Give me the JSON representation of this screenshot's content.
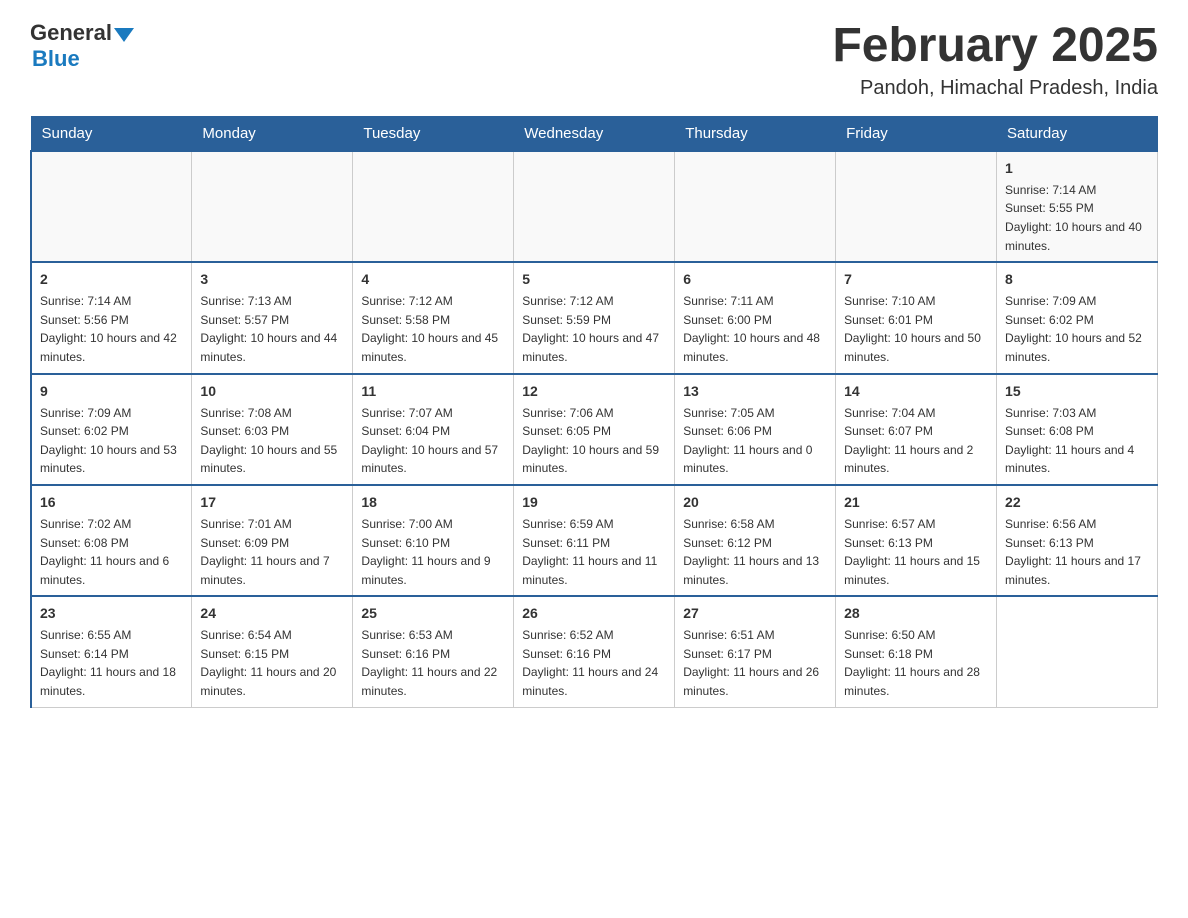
{
  "logo": {
    "part1": "General",
    "part2": "Blue"
  },
  "title": "February 2025",
  "subtitle": "Pandoh, Himachal Pradesh, India",
  "days_of_week": [
    "Sunday",
    "Monday",
    "Tuesday",
    "Wednesday",
    "Thursday",
    "Friday",
    "Saturday"
  ],
  "weeks": [
    [
      {
        "day": "",
        "info": ""
      },
      {
        "day": "",
        "info": ""
      },
      {
        "day": "",
        "info": ""
      },
      {
        "day": "",
        "info": ""
      },
      {
        "day": "",
        "info": ""
      },
      {
        "day": "",
        "info": ""
      },
      {
        "day": "1",
        "info": "Sunrise: 7:14 AM\nSunset: 5:55 PM\nDaylight: 10 hours and 40 minutes."
      }
    ],
    [
      {
        "day": "2",
        "info": "Sunrise: 7:14 AM\nSunset: 5:56 PM\nDaylight: 10 hours and 42 minutes."
      },
      {
        "day": "3",
        "info": "Sunrise: 7:13 AM\nSunset: 5:57 PM\nDaylight: 10 hours and 44 minutes."
      },
      {
        "day": "4",
        "info": "Sunrise: 7:12 AM\nSunset: 5:58 PM\nDaylight: 10 hours and 45 minutes."
      },
      {
        "day": "5",
        "info": "Sunrise: 7:12 AM\nSunset: 5:59 PM\nDaylight: 10 hours and 47 minutes."
      },
      {
        "day": "6",
        "info": "Sunrise: 7:11 AM\nSunset: 6:00 PM\nDaylight: 10 hours and 48 minutes."
      },
      {
        "day": "7",
        "info": "Sunrise: 7:10 AM\nSunset: 6:01 PM\nDaylight: 10 hours and 50 minutes."
      },
      {
        "day": "8",
        "info": "Sunrise: 7:09 AM\nSunset: 6:02 PM\nDaylight: 10 hours and 52 minutes."
      }
    ],
    [
      {
        "day": "9",
        "info": "Sunrise: 7:09 AM\nSunset: 6:02 PM\nDaylight: 10 hours and 53 minutes."
      },
      {
        "day": "10",
        "info": "Sunrise: 7:08 AM\nSunset: 6:03 PM\nDaylight: 10 hours and 55 minutes."
      },
      {
        "day": "11",
        "info": "Sunrise: 7:07 AM\nSunset: 6:04 PM\nDaylight: 10 hours and 57 minutes."
      },
      {
        "day": "12",
        "info": "Sunrise: 7:06 AM\nSunset: 6:05 PM\nDaylight: 10 hours and 59 minutes."
      },
      {
        "day": "13",
        "info": "Sunrise: 7:05 AM\nSunset: 6:06 PM\nDaylight: 11 hours and 0 minutes."
      },
      {
        "day": "14",
        "info": "Sunrise: 7:04 AM\nSunset: 6:07 PM\nDaylight: 11 hours and 2 minutes."
      },
      {
        "day": "15",
        "info": "Sunrise: 7:03 AM\nSunset: 6:08 PM\nDaylight: 11 hours and 4 minutes."
      }
    ],
    [
      {
        "day": "16",
        "info": "Sunrise: 7:02 AM\nSunset: 6:08 PM\nDaylight: 11 hours and 6 minutes."
      },
      {
        "day": "17",
        "info": "Sunrise: 7:01 AM\nSunset: 6:09 PM\nDaylight: 11 hours and 7 minutes."
      },
      {
        "day": "18",
        "info": "Sunrise: 7:00 AM\nSunset: 6:10 PM\nDaylight: 11 hours and 9 minutes."
      },
      {
        "day": "19",
        "info": "Sunrise: 6:59 AM\nSunset: 6:11 PM\nDaylight: 11 hours and 11 minutes."
      },
      {
        "day": "20",
        "info": "Sunrise: 6:58 AM\nSunset: 6:12 PM\nDaylight: 11 hours and 13 minutes."
      },
      {
        "day": "21",
        "info": "Sunrise: 6:57 AM\nSunset: 6:13 PM\nDaylight: 11 hours and 15 minutes."
      },
      {
        "day": "22",
        "info": "Sunrise: 6:56 AM\nSunset: 6:13 PM\nDaylight: 11 hours and 17 minutes."
      }
    ],
    [
      {
        "day": "23",
        "info": "Sunrise: 6:55 AM\nSunset: 6:14 PM\nDaylight: 11 hours and 18 minutes."
      },
      {
        "day": "24",
        "info": "Sunrise: 6:54 AM\nSunset: 6:15 PM\nDaylight: 11 hours and 20 minutes."
      },
      {
        "day": "25",
        "info": "Sunrise: 6:53 AM\nSunset: 6:16 PM\nDaylight: 11 hours and 22 minutes."
      },
      {
        "day": "26",
        "info": "Sunrise: 6:52 AM\nSunset: 6:16 PM\nDaylight: 11 hours and 24 minutes."
      },
      {
        "day": "27",
        "info": "Sunrise: 6:51 AM\nSunset: 6:17 PM\nDaylight: 11 hours and 26 minutes."
      },
      {
        "day": "28",
        "info": "Sunrise: 6:50 AM\nSunset: 6:18 PM\nDaylight: 11 hours and 28 minutes."
      },
      {
        "day": "",
        "info": ""
      }
    ]
  ]
}
